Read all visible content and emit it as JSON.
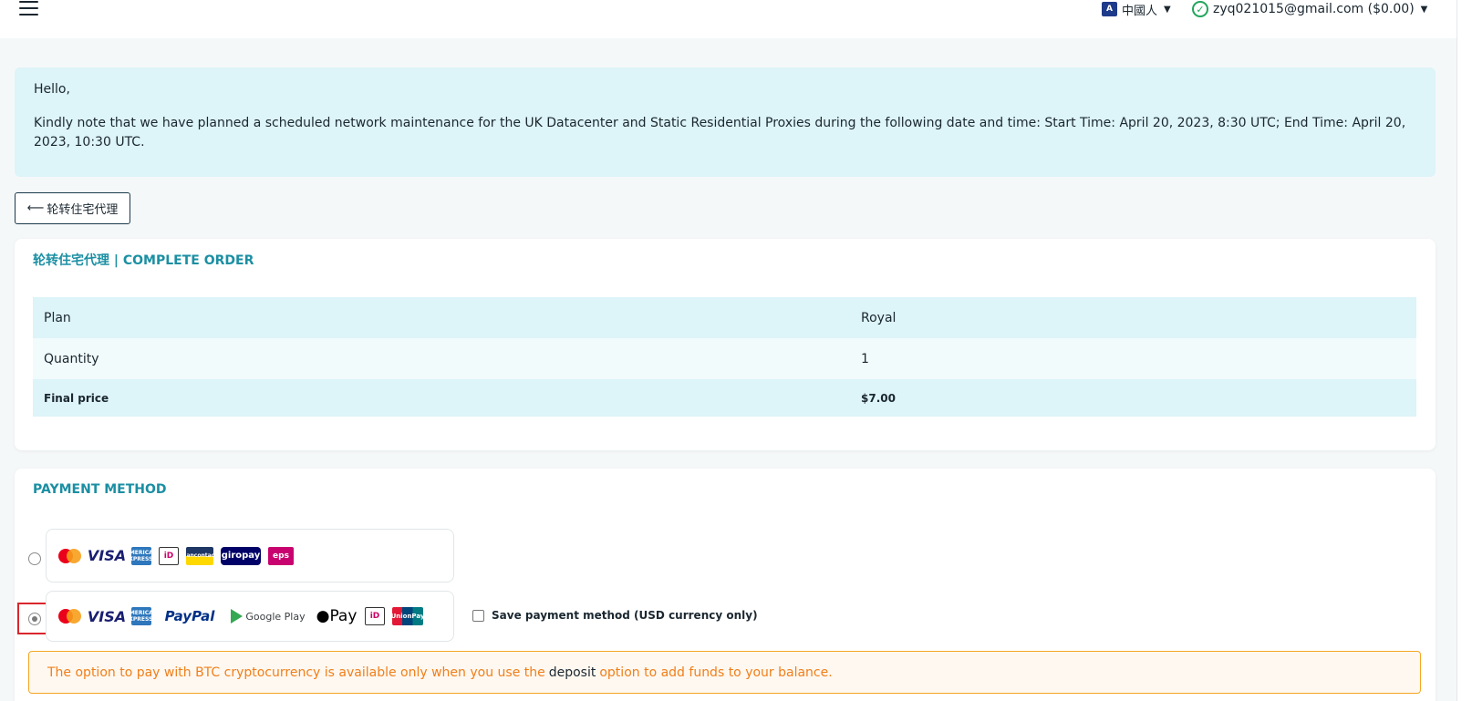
{
  "header": {
    "language_label": "中國人",
    "language_icon": "translate-icon",
    "account_label": "zyq021015@gmail.com ($0.00)",
    "account_icon": "check-circle-icon"
  },
  "notice": {
    "greeting": "Hello,",
    "message": "Kindly note that we have planned a scheduled network maintenance for the UK Datacenter and Static Residential Proxies during the following date and time: Start Time: April 20, 2023, 8:30 UTC; End Time: April 20, 2023, 10:30 UTC."
  },
  "back_button": {
    "arrow": "⟵",
    "label": "轮转住宅代理"
  },
  "order": {
    "title": "轮转住宅代理 | COMPLETE ORDER",
    "rows": [
      {
        "label": "Plan",
        "value": "Royal"
      },
      {
        "label": "Quantity",
        "value": "1"
      },
      {
        "label": "Final price",
        "value": "$7.00"
      }
    ]
  },
  "payment": {
    "title": "PAYMENT METHOD",
    "option1_logos": [
      "mastercard-logo",
      "visa-logo",
      "amex-logo",
      "ideal-logo",
      "bancontact-logo",
      "giropay-logo",
      "eps-logo"
    ],
    "option2_logos": [
      "mastercard-logo",
      "visa-logo",
      "amex-logo",
      "paypal-logo",
      "google-play-logo",
      "apple-pay-logo",
      "ideal-logo",
      "unionpay-logo"
    ],
    "selected_option": 2,
    "logo_text": {
      "visa": "VISA",
      "amex": "AMERICAN EXPRESS",
      "ideal": "iD",
      "bancontact": "Bancontact",
      "giropay": "giropay",
      "eps": "eps",
      "paypal": "PayPal",
      "google_play": "Google Play",
      "apple_pay": "Pay",
      "unionpay": "UnionPay"
    },
    "save_label": "Save payment method (USD currency only)",
    "btc_before": "The option to pay with BTC cryptocurrency is available only when you use the",
    "btc_link": "deposit",
    "btc_after": "option to add funds to your balance."
  },
  "colors": {
    "accent": "#1b8fa3",
    "notice_bg": "#ddf4f8",
    "warning": "#f07f1a",
    "focus_outline": "#d9262c"
  }
}
